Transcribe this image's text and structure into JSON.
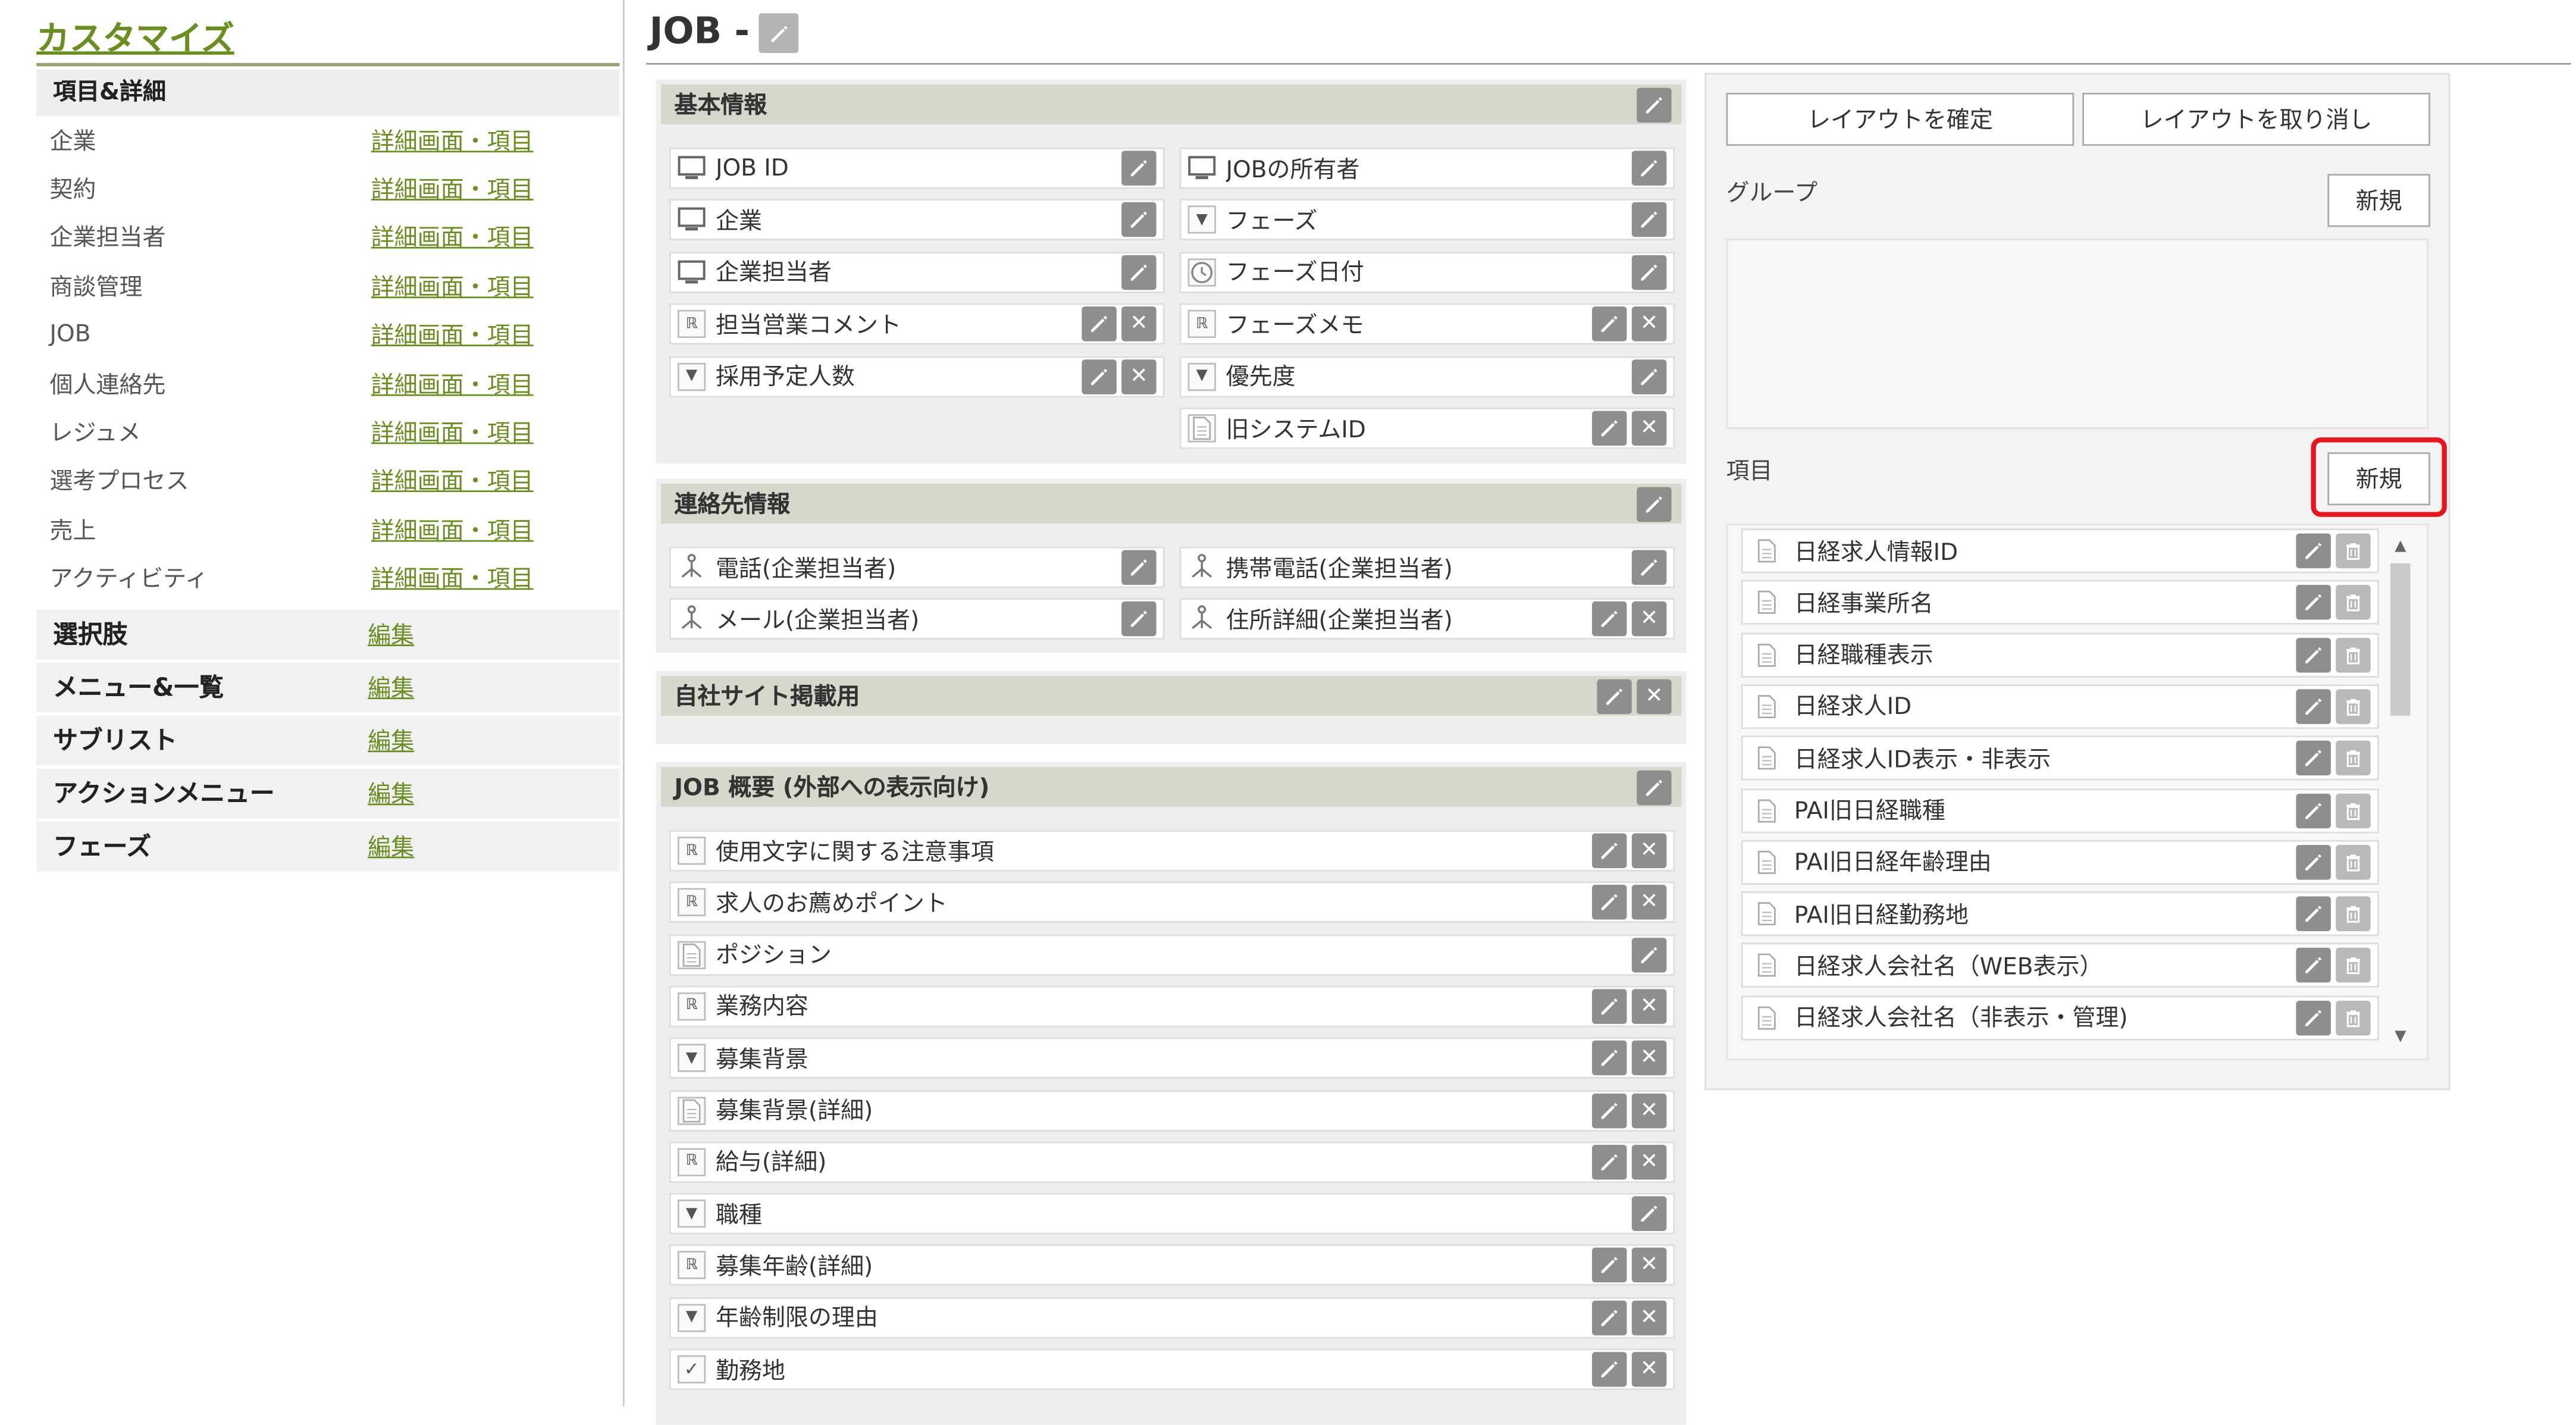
{
  "sidebar": {
    "title": "カスタマイズ",
    "section_items_details": "項目&詳細",
    "rows": [
      {
        "label": "企業",
        "link": "詳細画面・項目"
      },
      {
        "label": "契約",
        "link": "詳細画面・項目"
      },
      {
        "label": "企業担当者",
        "link": "詳細画面・項目"
      },
      {
        "label": "商談管理",
        "link": "詳細画面・項目"
      },
      {
        "label": "JOB",
        "link": "詳細画面・項目"
      },
      {
        "label": "個人連絡先",
        "link": "詳細画面・項目"
      },
      {
        "label": "レジュメ",
        "link": "詳細画面・項目"
      },
      {
        "label": "選考プロセス",
        "link": "詳細画面・項目"
      },
      {
        "label": "売上",
        "link": "詳細画面・項目"
      },
      {
        "label": "アクティビティ",
        "link": "詳細画面・項目"
      }
    ],
    "sections": [
      {
        "label": "選択肢",
        "link": "編集"
      },
      {
        "label": "メニュー&一覧",
        "link": "編集"
      },
      {
        "label": "サブリスト",
        "link": "編集"
      },
      {
        "label": "アクションメニュー",
        "link": "編集"
      },
      {
        "label": "フェーズ",
        "link": "編集"
      }
    ]
  },
  "page": {
    "title": "JOB -"
  },
  "layout": {
    "basic": {
      "title": "基本情報",
      "left": [
        "JOB ID",
        "企業",
        "企業担当者",
        "担当営業コメント",
        "採用予定人数"
      ],
      "right": [
        "JOBの所有者",
        "フェーズ",
        "フェーズ日付",
        "フェーズメモ",
        "優先度",
        "旧システムID"
      ]
    },
    "contact": {
      "title": "連絡先情報",
      "left": [
        "電話(企業担当者)",
        "メール(企業担当者)"
      ],
      "right": [
        "携帯電話(企業担当者)",
        "住所詳細(企業担当者)"
      ]
    },
    "own_site": {
      "title": "自社サイト掲載用"
    },
    "overview": {
      "title": "JOB 概要 (外部への表示向け)",
      "fields": [
        "使用文字に関する注意事項",
        "求人のお薦めポイント",
        "ポジション",
        "業務内容",
        "募集背景",
        "募集背景(詳細)",
        "給与(詳細)",
        "職種",
        "募集年齢(詳細)",
        "年齢制限の理由",
        "勤務地"
      ]
    }
  },
  "palette": {
    "confirm_button": "レイアウトを確定",
    "cancel_button": "レイアウトを取り消し",
    "group_label": "グループ",
    "group_new_button": "新規",
    "item_label": "項目",
    "item_new_button": "新規",
    "items": [
      "日経求人情報ID",
      "日経事業所名",
      "日経職種表示",
      "日経求人ID",
      "日経求人ID表示・非表示",
      "PAI旧日経職種",
      "PAI旧日経年齢理由",
      "PAI旧日経勤務地",
      "日経求人会社名（WEB表示）",
      "日経求人会社名（非表示・管理)"
    ]
  },
  "colors": {
    "accent_green": "#6b8e23",
    "section_header": "#d7d7cb",
    "highlight_red": "#e8161c"
  }
}
